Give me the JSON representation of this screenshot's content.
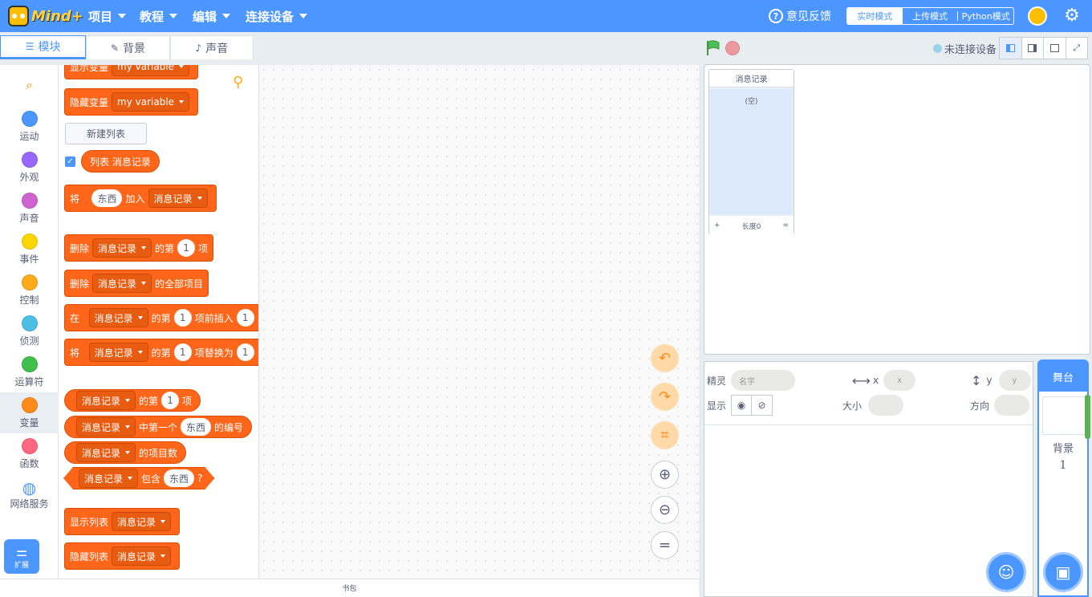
{
  "app": {
    "logo": "Mind+"
  },
  "topbar": {
    "menus": [
      "项目",
      "教程",
      "编辑",
      "连接设备"
    ],
    "feedback": "意见反馈",
    "modes": [
      "实时模式",
      "上传模式",
      "Python模式"
    ]
  },
  "tabs": [
    "模块",
    "背景",
    "声音"
  ],
  "categories": [
    {
      "label": "运动",
      "color": "#4c97ff"
    },
    {
      "label": "外观",
      "color": "#9966ff"
    },
    {
      "label": "声音",
      "color": "#cf63cf"
    },
    {
      "label": "事件",
      "color": "#ffd500"
    },
    {
      "label": "控制",
      "color": "#ffab19"
    },
    {
      "label": "侦测",
      "color": "#4cbfe6"
    },
    {
      "label": "运算符",
      "color": "#40bf4a"
    },
    {
      "label": "变量",
      "color": "#ff8c1a"
    },
    {
      "label": "函数",
      "color": "#ff6680"
    },
    {
      "label": "网络服务",
      "color": "#4c97ff"
    }
  ],
  "extensions_label": "扩展",
  "palette": {
    "show_var": "显示变量",
    "hide_var": "隐藏变量",
    "var_name": "my variable",
    "new_list": "新建列表",
    "list_prefix": "列表",
    "list_name": "消息记录",
    "add_pre": "将",
    "thing": "东西",
    "add_post": "加入",
    "delete": "删除",
    "nth": "的第",
    "item": "项",
    "one": "1",
    "delete_all": "的全部项目",
    "at": "在",
    "insert_before": "项前插入",
    "replace": "项替换为",
    "first_index": "中第一个",
    "index_of": "的编号",
    "length": "的项目数",
    "contains": "包含",
    "question": "?",
    "show_list": "显示列表",
    "hide_list": "隐藏列表"
  },
  "bag_label": "书包",
  "stage": {
    "status": "未连接设备",
    "monitor": {
      "title": "消息记录",
      "empty": "(空)",
      "plus": "+",
      "length": "长度0",
      "equals": "="
    }
  },
  "sprite_info": {
    "sprite_label": "精灵",
    "name_placeholder": "名字",
    "x_label": "x",
    "x_placeholder": "x",
    "y_label": "y",
    "y_placeholder": "y",
    "show_label": "显示",
    "size_label": "大小",
    "direction_label": "方向"
  },
  "stage_panel": {
    "title": "舞台",
    "backdrop_label": "背景",
    "backdrop_count": "1"
  }
}
